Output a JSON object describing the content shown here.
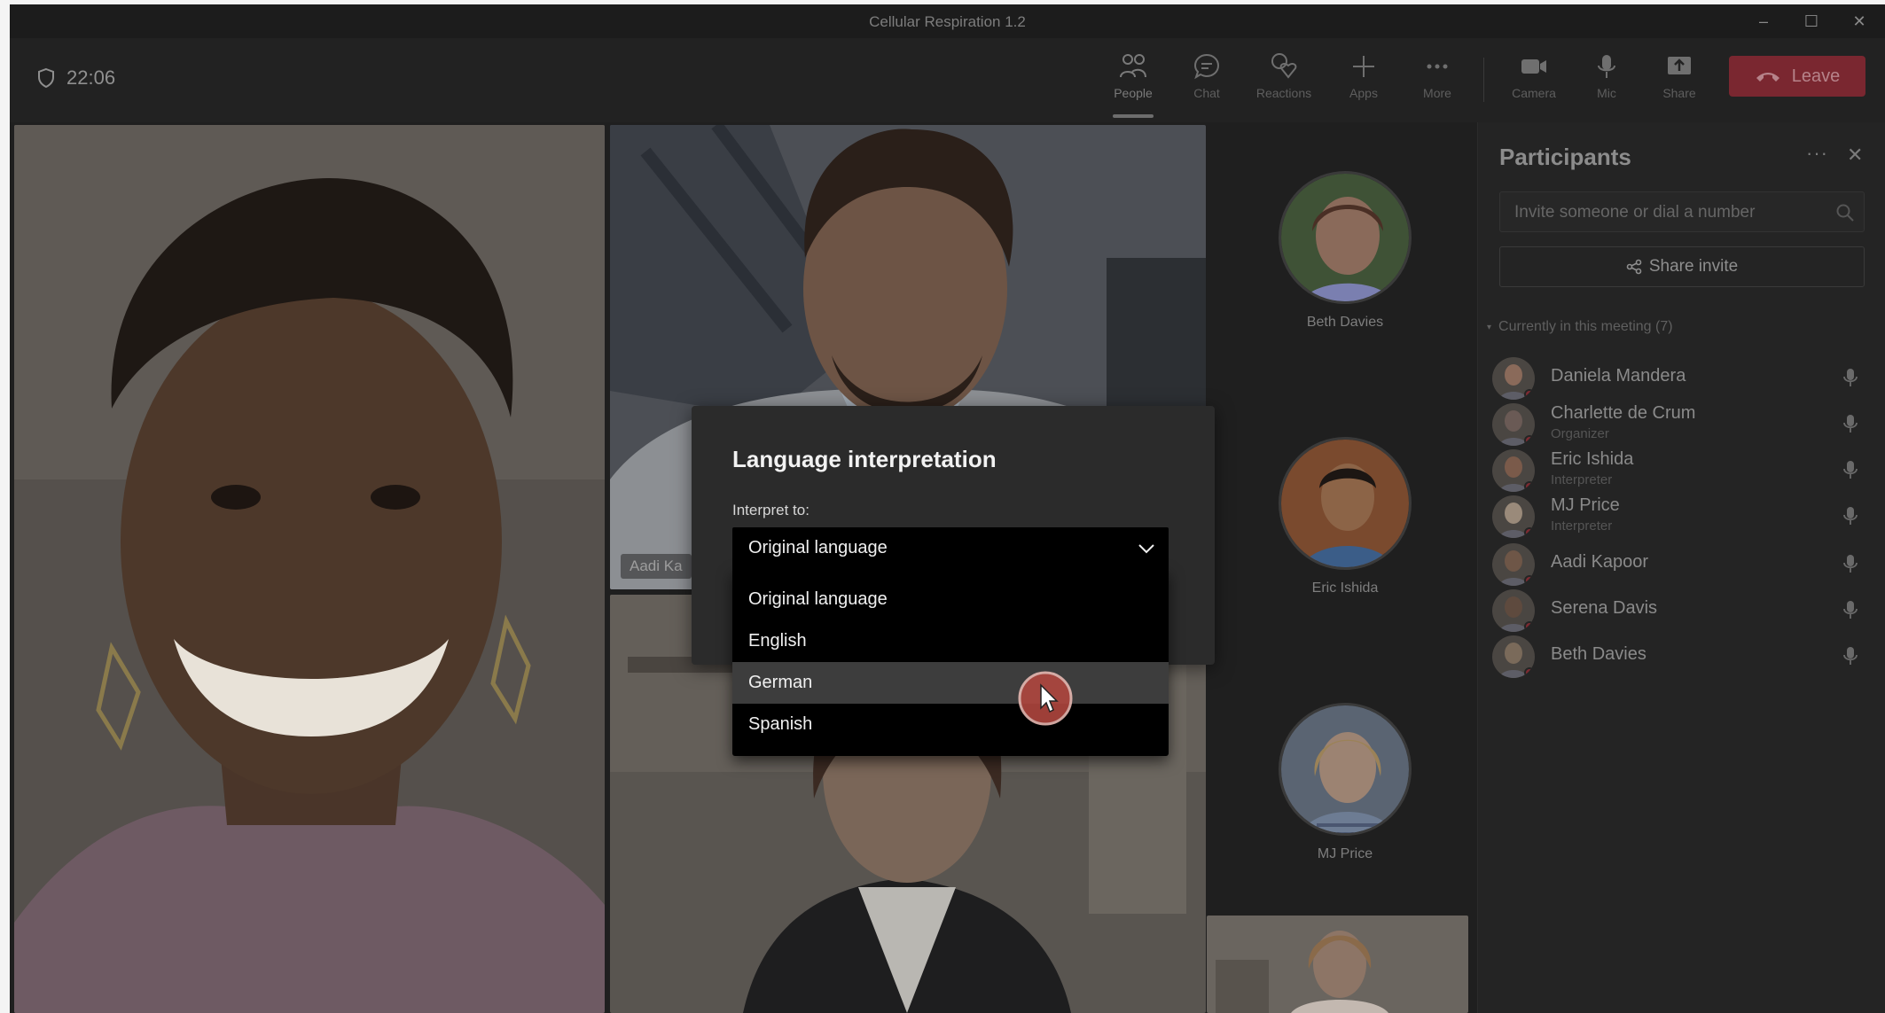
{
  "window": {
    "title": "Cellular Respiration 1.2",
    "controls": [
      "–",
      "☐",
      "✕"
    ]
  },
  "toolbar": {
    "timer": "22:06",
    "buttons": [
      {
        "label": "People",
        "icon": "people-icon"
      },
      {
        "label": "Chat",
        "icon": "chat-icon"
      },
      {
        "label": "Reactions",
        "icon": "reactions-icon"
      },
      {
        "label": "Apps",
        "icon": "apps-icon"
      },
      {
        "label": "More",
        "icon": "more-icon"
      },
      {
        "label": "Camera",
        "icon": "camera-icon"
      },
      {
        "label": "Mic",
        "icon": "mic-icon"
      },
      {
        "label": "Share",
        "icon": "share-icon"
      }
    ],
    "leave_label": "Leave",
    "leave_color": "#7a2730"
  },
  "stage": {
    "tile_names": [
      "Aadi Ka"
    ],
    "side_avatars": [
      {
        "name": "Beth Davies"
      },
      {
        "name": "Eric Ishida"
      },
      {
        "name": "MJ Price"
      }
    ]
  },
  "participants": {
    "title": "Participants",
    "more": "···",
    "invite_placeholder": "Invite someone or dial a number",
    "share_invite": "Share invite",
    "section_header": "Currently in this meeting (7)",
    "people": [
      {
        "name": "Daniela Mandera",
        "role": ""
      },
      {
        "name": "Charlette de Crum",
        "role": "Organizer"
      },
      {
        "name": "Eric Ishida",
        "role": "Interpreter"
      },
      {
        "name": "MJ Price",
        "role": "Interpreter"
      },
      {
        "name": "Aadi Kapoor",
        "role": ""
      },
      {
        "name": "Serena Davis",
        "role": ""
      },
      {
        "name": "Beth Davies",
        "role": ""
      }
    ]
  },
  "dialog": {
    "title": "Language interpretation",
    "field_label": "Interpret to:",
    "selected": "Original language",
    "options": [
      "Original language",
      "English",
      "German",
      "Spanish"
    ],
    "hovered_option": "German"
  }
}
